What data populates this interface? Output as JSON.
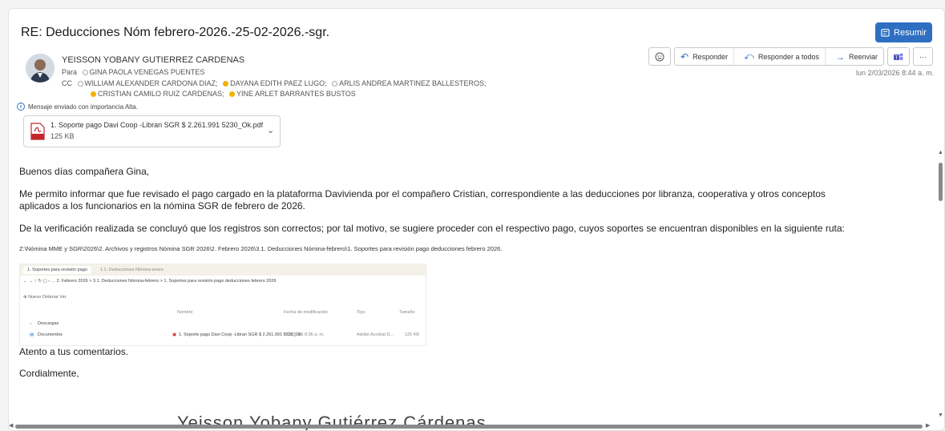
{
  "email": {
    "subject": "RE: Deducciones Nóm febrero-2026.-25-02-2026.-sgr.",
    "summarize_label": "Resumir",
    "sender": "YEISSON YOBANY GUTIERREZ CARDENAS",
    "to_label": "Para",
    "to": "GINA PAOLA VENEGAS PUENTES",
    "cc_label": "CC",
    "cc": [
      "WILLIAM ALEXANDER CARDONA DIAZ;",
      "DAYANA EDITH PAEZ LUGO;",
      "ARLIS ANDREA MARTINEZ BALLESTEROS;",
      "CRISTIAN CAMILO RUIZ CARDENAS;",
      "YINE ARLET BARRANTES BUSTOS"
    ],
    "importance": "Mensaje enviado con importancia Alta.",
    "date": "lun 2/03/2026 8:44 a. m.",
    "attachment": {
      "name": "1. Soporte pago Davi Coop -Libran SGR $ 2.261.991 5230_Ok.pdf",
      "size": "125 KB",
      "icon": "pdf-icon"
    },
    "actions": {
      "reply": "Responder",
      "reply_all": "Responder a todos",
      "forward": "Reenviar"
    },
    "body": {
      "greeting": "Buenos días compañera Gina,",
      "p1": "Me permito informar que fue revisado el pago cargado en la plataforma Davivienda por el compañero Cristian, correspondiente a las deducciones por libranza, cooperativa y otros conceptos",
      "p1b": "aplicados a los funcionarios en la nómina SGR de febrero de 2026.",
      "p2": "De la verificación realizada se concluyó que los registros son correctos; por tal motivo, se sugiere proceder con el respectivo pago, cuyos soportes se encuentran disponibles en la siguiente ruta:",
      "path": "Z:\\Nómina MME y SGR\\2026\\2. Archivos y registros Nómina SGR 2026\\2. Febrero 2026\\3.1. Deducciones Nómina-febrero\\1. Soportes para revisión pago deducciones febrero 2026.",
      "closing1": "Atento a tus comentarios.",
      "closing2": "Cordialmente,",
      "signature": "Yeisson Yobany Gutiérrez Cárdenas"
    },
    "explorer": {
      "tab1": "1. Soportes para revisión pago",
      "tab2": "1.1. Deducciones Nómina-enero",
      "address": "2. Febrero 2026   >   3.1. Deducciones Nómina-febrero   >   1. Soportes para revisión pago deducciones febrero 2026",
      "toolbar": "Nuevo        Ordenar        Ver",
      "col_name": "Nombre",
      "col_date": "Fecha de modificación",
      "col_type": "Tipo",
      "col_size": "Tamaño",
      "side1": "Descargas",
      "side2": "Documentos",
      "file": "1. Soporte pago Davi Coop -Libran SGR $ 2.261.991 5230_Ok",
      "file_date": "2/03/2026 8:36 a. m.",
      "file_type": "Adobe Acrobat D...",
      "file_size": "125 KB"
    }
  },
  "colors": {
    "accent": "#2f6fc2",
    "presence": "#f2b200"
  }
}
